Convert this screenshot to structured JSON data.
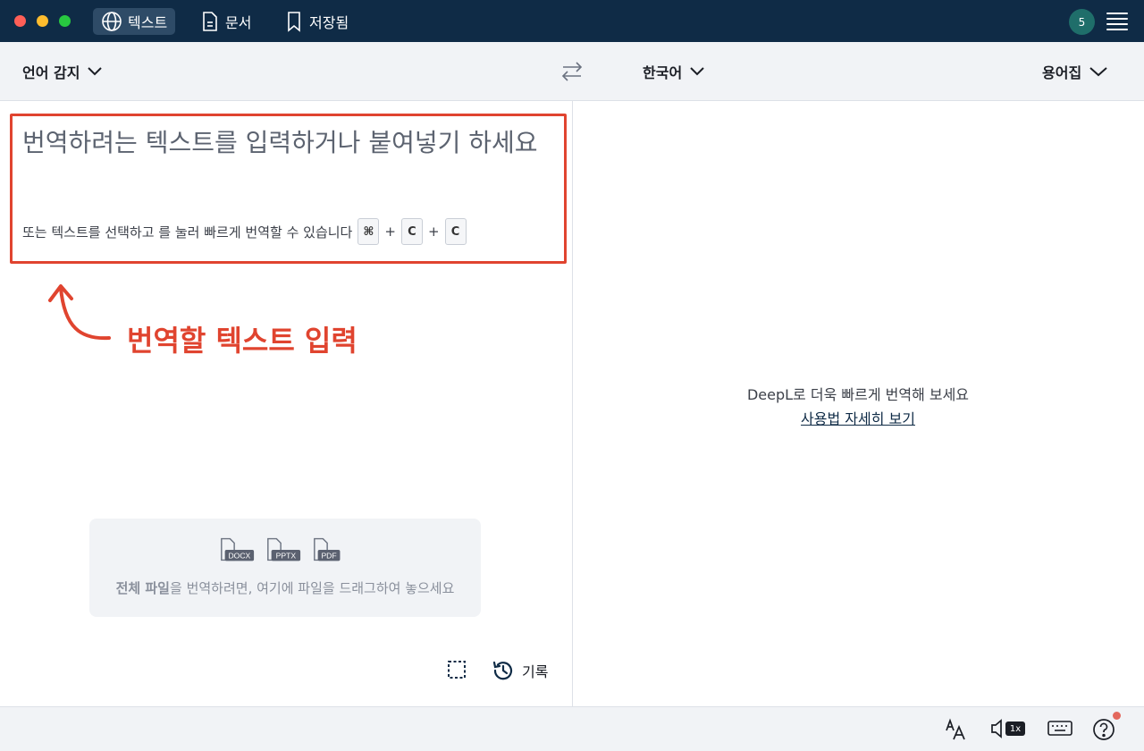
{
  "titlebar": {
    "tabs": [
      {
        "label": "텍스트",
        "icon": "globe-icon",
        "active": true
      },
      {
        "label": "문서",
        "icon": "document-icon",
        "active": false
      },
      {
        "label": "저장됨",
        "icon": "bookmark-icon",
        "active": false
      }
    ],
    "avatar_label": "5"
  },
  "langbar": {
    "source_lang": "언어 감지",
    "target_lang": "한국어",
    "glossary": "용어집"
  },
  "input": {
    "placeholder": "번역하려는 텍스트를 입력하거나 붙여넣기 하세요",
    "hint": "또는 텍스트를 선택하고 를 눌러 빠르게 번역할 수 있습니다",
    "shortcut_keys": [
      "⌘",
      "C",
      "C"
    ],
    "shortcut_sep": "+"
  },
  "annotation": {
    "label": "번역할 텍스트 입력",
    "color": "#e0442f"
  },
  "dropzone": {
    "file_types": [
      "DOCX",
      "PPTX",
      "PDF"
    ],
    "bold_text": "전체 파일",
    "text": "을 번역하려면, 여기에 파일을 드래그하여 놓으세요"
  },
  "tools": {
    "history_label": "기록"
  },
  "output": {
    "promo_text": "DeepL로 더욱 빠르게 번역해 보세요",
    "promo_link": "사용법 자세히 보기"
  },
  "bottombar": {
    "speed_badge": "1x"
  },
  "colors": {
    "titlebar": "#0f2b46",
    "accent": "#0f2b46",
    "annotation": "#e0442f"
  }
}
